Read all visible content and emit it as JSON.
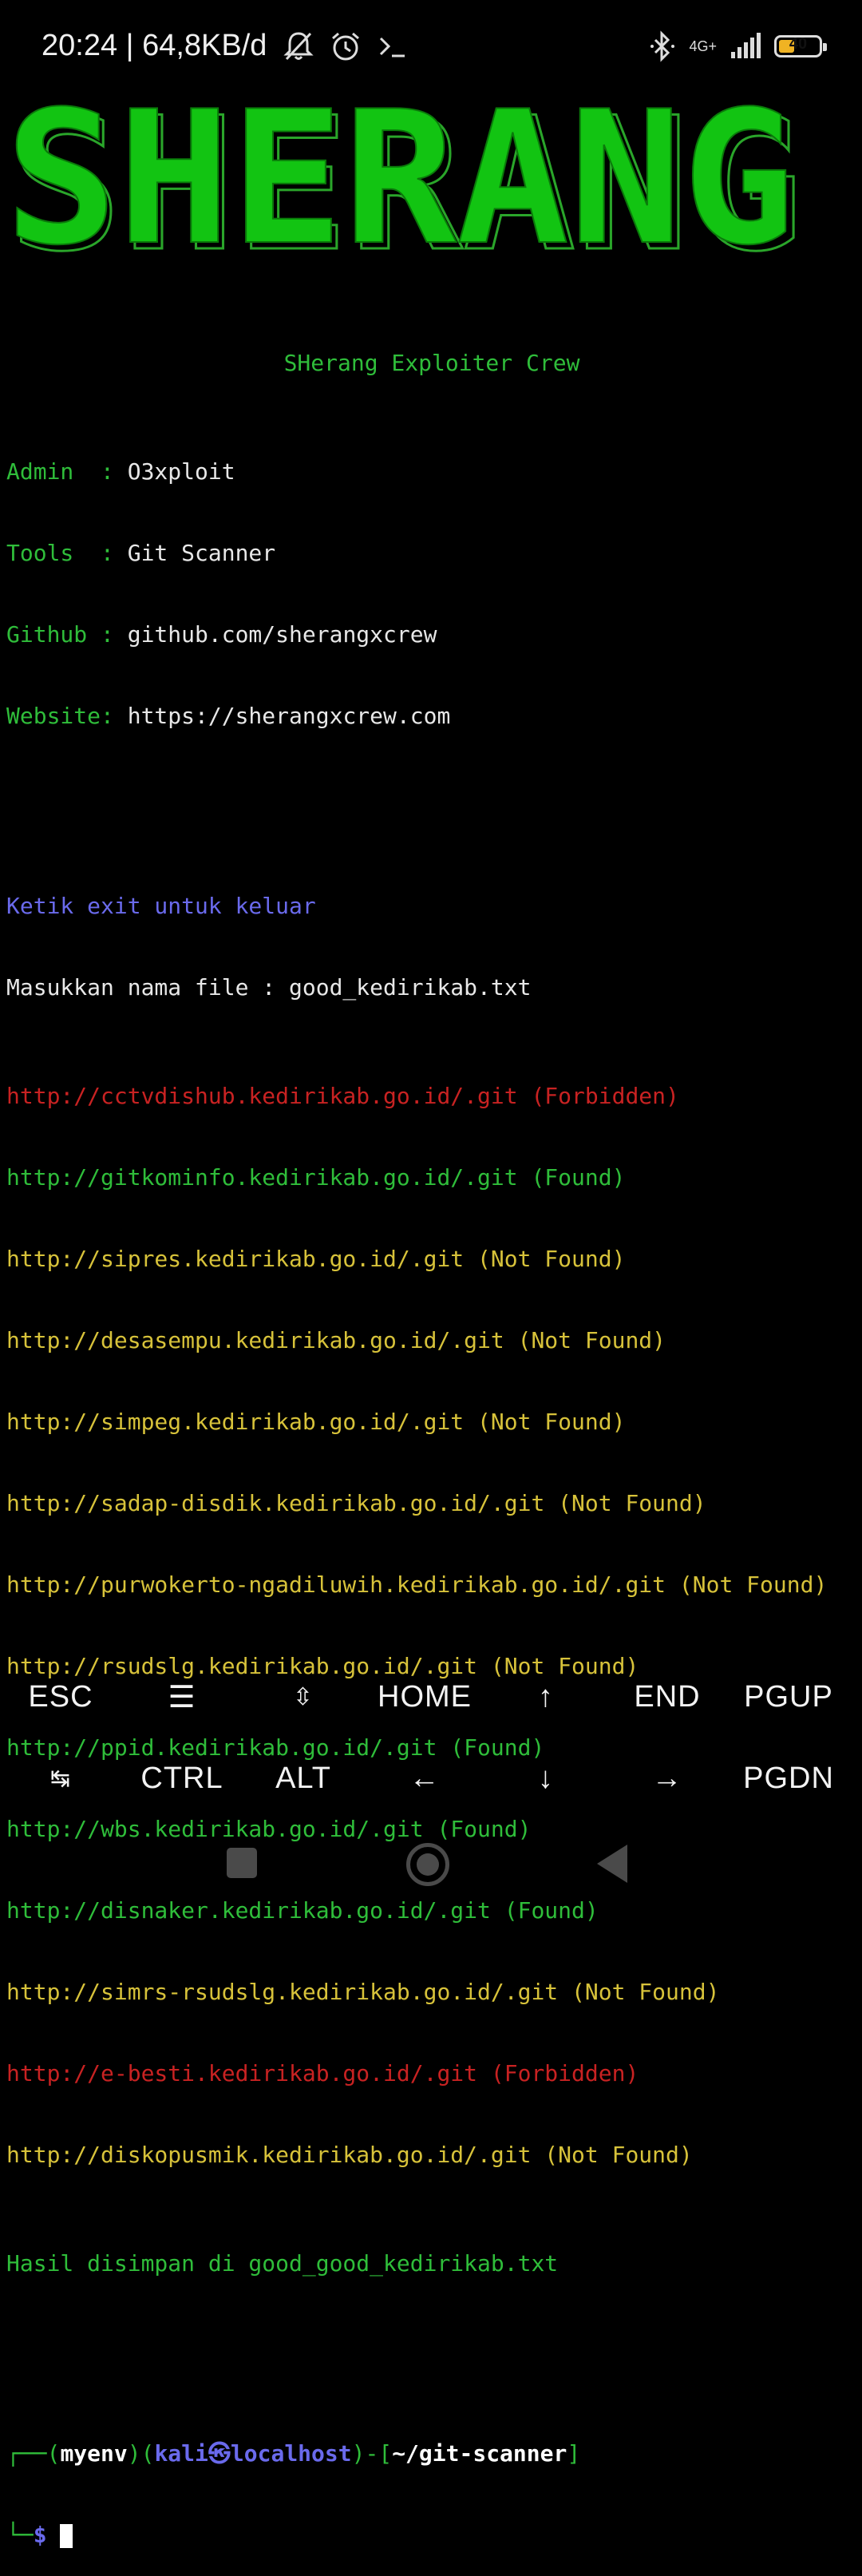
{
  "status_bar": {
    "time": "20:24 | 64,8KB/d",
    "network": "4G+",
    "battery_level": "40",
    "battery_fraction": 0.4
  },
  "banner": {
    "text": "SHERANG",
    "fill_color": "#12c412",
    "outline_color": "#2aa52a"
  },
  "terminal": {
    "header": "SHerang Exploiter Crew",
    "info": [
      {
        "label": "Admin  : ",
        "value": "O3xploit"
      },
      {
        "label": "Tools  : ",
        "value": "Git Scanner"
      },
      {
        "label": "Github : ",
        "value": "github.com/sherangxcrew"
      },
      {
        "label": "Website: ",
        "value": "https://sherangxcrew.com"
      }
    ],
    "exit_hint": "Ketik exit untuk keluar",
    "input_prompt": "Masukkan nama file : good_kedirikab.txt",
    "results": [
      {
        "text": "http://cctvdishub.kedirikab.go.id/.git (Forbidden)",
        "status": "forbidden"
      },
      {
        "text": "http://gitkominfo.kedirikab.go.id/.git (Found)",
        "status": "found"
      },
      {
        "text": "http://sipres.kedirikab.go.id/.git (Not Found)",
        "status": "notfound"
      },
      {
        "text": "http://desasempu.kedirikab.go.id/.git (Not Found)",
        "status": "notfound"
      },
      {
        "text": "http://simpeg.kedirikab.go.id/.git (Not Found)",
        "status": "notfound"
      },
      {
        "text": "http://sadap-disdik.kedirikab.go.id/.git (Not Found)",
        "status": "notfound"
      },
      {
        "text": "http://purwokerto-ngadiluwih.kedirikab.go.id/.git (Not Found)",
        "status": "notfound"
      },
      {
        "text": "http://rsudslg.kedirikab.go.id/.git (Not Found)",
        "status": "notfound"
      },
      {
        "text": "http://ppid.kedirikab.go.id/.git (Found)",
        "status": "found"
      },
      {
        "text": "http://wbs.kedirikab.go.id/.git (Found)",
        "status": "found"
      },
      {
        "text": "http://disnaker.kedirikab.go.id/.git (Found)",
        "status": "found"
      },
      {
        "text": "http://simrs-rsudslg.kedirikab.go.id/.git (Not Found)",
        "status": "notfound"
      },
      {
        "text": "http://e-besti.kedirikab.go.id/.git (Forbidden)",
        "status": "forbidden"
      },
      {
        "text": "http://diskopusmik.kedirikab.go.id/.git (Not Found)",
        "status": "notfound"
      }
    ],
    "saved_message": "Hasil disimpan di good_good_kedirikab.txt",
    "prompt": {
      "corner_top": "┌──(",
      "env": "myenv",
      "mid1": ")(",
      "user_host": "kali㉿localhost",
      "mid2": ")-[",
      "path": "~/git-scanner",
      "close": "]",
      "corner_bottom": "└─",
      "symbol": "$"
    }
  },
  "extra_keys": {
    "row1": [
      "ESC",
      "☰",
      "⇳",
      "HOME",
      "↑",
      "END",
      "PGUP"
    ],
    "row2": [
      "↹",
      "CTRL",
      "ALT",
      "←",
      "↓",
      "→",
      "PGDN"
    ]
  },
  "colors": {
    "found": "#2fbd3a",
    "notfound": "#d7c23a",
    "forbidden": "#c82222",
    "hint": "#6a6aec"
  }
}
